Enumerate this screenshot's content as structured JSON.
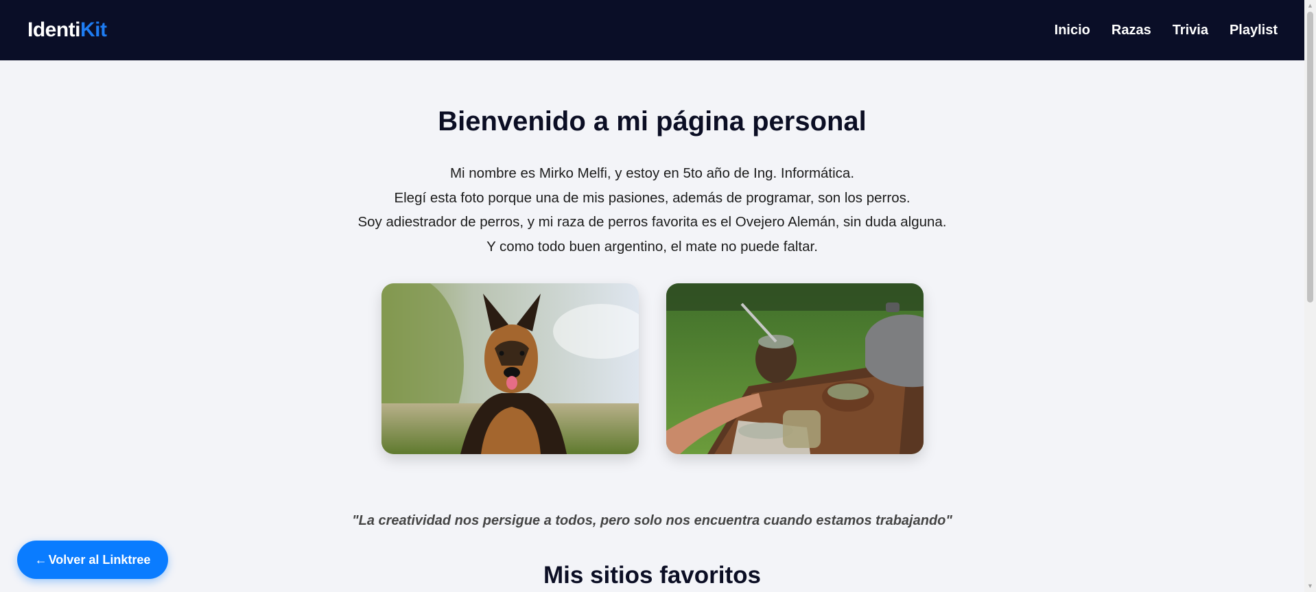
{
  "header": {
    "logo_part1": "Identi",
    "logo_part2": "Kit",
    "nav": [
      {
        "label": "Inicio"
      },
      {
        "label": "Razas"
      },
      {
        "label": "Trivia"
      },
      {
        "label": "Playlist"
      }
    ]
  },
  "main": {
    "title": "Bienvenido a mi página personal",
    "intro_lines": [
      "Mi nombre es Mirko Melfi, y estoy en 5to año de Ing. Informática.",
      "Elegí esta foto porque una de mis pasiones, además de programar, son los perros.",
      "Soy adiestrador de perros, y mi raza de perros favorita es el Ovejero Alemán, sin duda alguna.",
      "Y como todo buen argentino, el mate no puede faltar."
    ],
    "quote": "\"La creatividad nos persigue a todos, pero solo nos encuentra cuando estamos trabajando\"",
    "favorites_heading": "Mis sitios favoritos"
  },
  "back_button": {
    "arrow": "←",
    "label": "Volver al Linktree"
  },
  "colors": {
    "header_bg": "#0a0e27",
    "accent": "#1e7cf2",
    "button": "#0a7cff",
    "page_bg": "#f3f4f8"
  }
}
